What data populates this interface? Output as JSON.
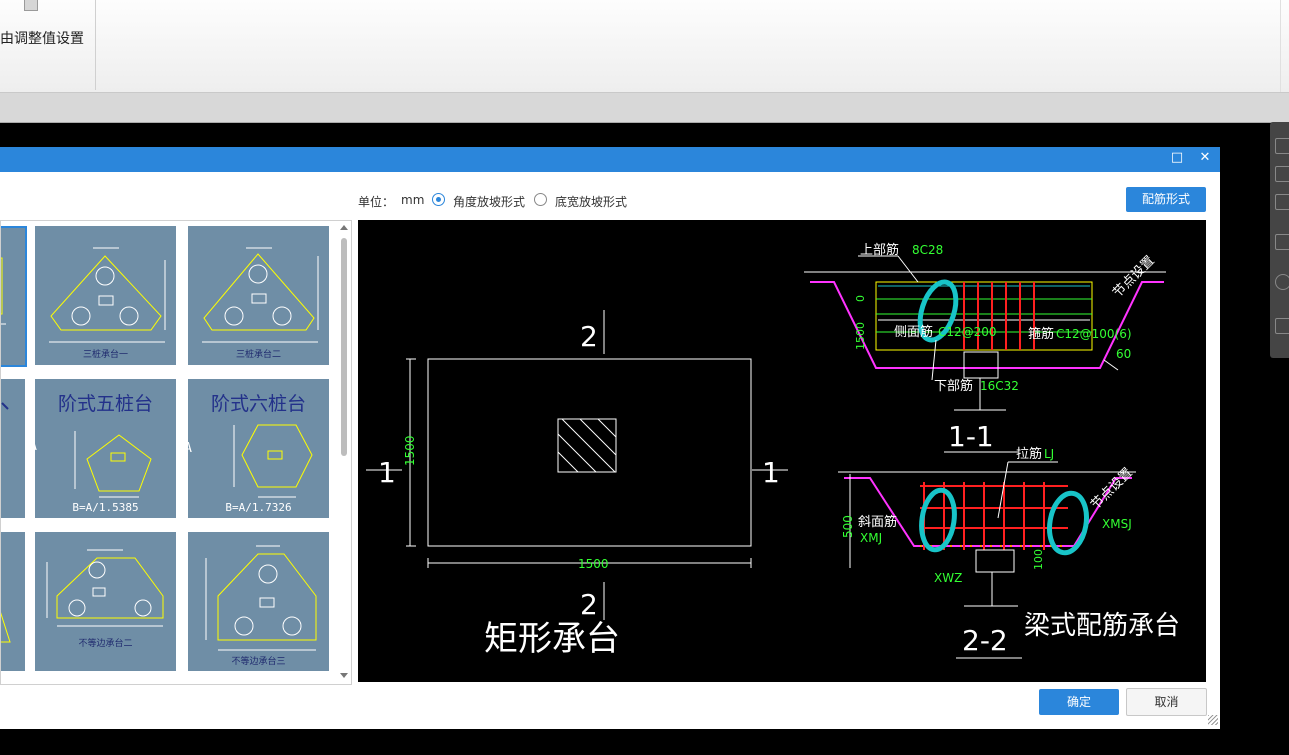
{
  "ribbon": {
    "button_label": "由调整值设置"
  },
  "dialog": {
    "window_controls": {
      "maximize": "□",
      "close": "✕"
    },
    "unit_label": "单位：",
    "unit_value": "mm",
    "radio_angle": "角度放坡形式",
    "radio_width": "底宽放坡形式",
    "rebar_button": "配筋形式",
    "ok_button": "确定",
    "cancel_button": "取消"
  },
  "gallery": {
    "items": [
      {
        "caption": "三桩承台一"
      },
      {
        "caption": "三桩承台二"
      },
      {
        "title": "阶式五桩台",
        "dim": "A",
        "formula": "B=A/1.5385"
      },
      {
        "title": "阶式六桩台",
        "dim": "A",
        "formula": "B=A/1.7326"
      },
      {
        "caption": "不等边承台二"
      },
      {
        "caption": "不等边承台三"
      }
    ]
  },
  "drawing": {
    "plan": {
      "title": "矩形承台",
      "section_top": "2",
      "section_bottom": "2",
      "section_left": "1",
      "section_right": "1",
      "dim_width": "1500",
      "dim_height": "1500"
    },
    "section_1": {
      "label": "1-1",
      "top_bar_label": "上部筋",
      "top_bar_value": "8C28",
      "side_bar_label": "侧面筋",
      "side_bar_value": "C12@200",
      "stirrup_label": "箍筋",
      "stirrup_value": "C12@100(6)",
      "bottom_bar_label": "下部筋",
      "bottom_bar_value": "16C32",
      "node_label": "节点设置",
      "angle": "60",
      "dim_0": "0",
      "dim_left": "1500"
    },
    "section_2": {
      "label": "2-2",
      "tie_label": "拉筋",
      "tie_value": "LJ",
      "slope_label": "斜面筋",
      "slope_left": "XMJ",
      "slope_right": "XMSJ",
      "bottom": "XWZ",
      "dim_500": "500",
      "dim_100": "100",
      "node_label": "节点设置",
      "title": "梁式配筋承台"
    }
  },
  "colors": {
    "titlebar": "#2b86db",
    "thumb_bg": "#6f8ea6",
    "cad_white": "#ffffff",
    "cad_green": "#33ff33",
    "cad_yellow": "#ffff00",
    "cad_red": "#ff2020",
    "cad_magenta": "#ff33ff",
    "cad_cyan_annotation": "#18c4c8"
  }
}
